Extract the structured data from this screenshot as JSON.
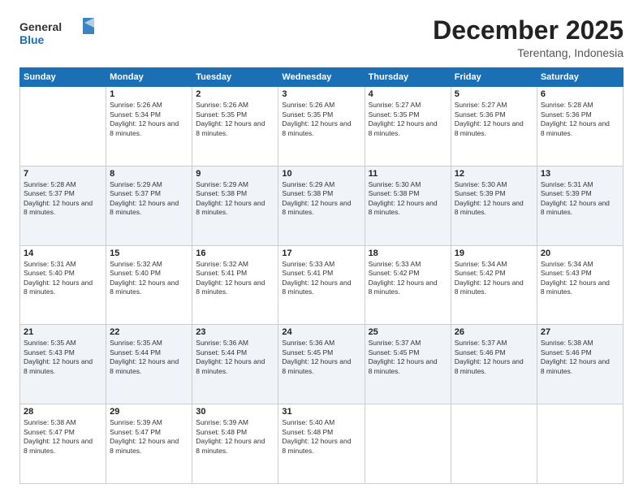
{
  "logo": {
    "general": "General",
    "blue": "Blue"
  },
  "title": "December 2025",
  "location": "Terentang, Indonesia",
  "days_of_week": [
    "Sunday",
    "Monday",
    "Tuesday",
    "Wednesday",
    "Thursday",
    "Friday",
    "Saturday"
  ],
  "weeks": [
    [
      {
        "day": "",
        "sunrise": "",
        "sunset": "",
        "daylight": ""
      },
      {
        "day": "1",
        "sunrise": "5:26 AM",
        "sunset": "5:34 PM",
        "daylight": "12 hours and 8 minutes."
      },
      {
        "day": "2",
        "sunrise": "5:26 AM",
        "sunset": "5:35 PM",
        "daylight": "12 hours and 8 minutes."
      },
      {
        "day": "3",
        "sunrise": "5:26 AM",
        "sunset": "5:35 PM",
        "daylight": "12 hours and 8 minutes."
      },
      {
        "day": "4",
        "sunrise": "5:27 AM",
        "sunset": "5:35 PM",
        "daylight": "12 hours and 8 minutes."
      },
      {
        "day": "5",
        "sunrise": "5:27 AM",
        "sunset": "5:36 PM",
        "daylight": "12 hours and 8 minutes."
      },
      {
        "day": "6",
        "sunrise": "5:28 AM",
        "sunset": "5:36 PM",
        "daylight": "12 hours and 8 minutes."
      }
    ],
    [
      {
        "day": "7",
        "sunrise": "5:28 AM",
        "sunset": "5:37 PM",
        "daylight": "12 hours and 8 minutes."
      },
      {
        "day": "8",
        "sunrise": "5:29 AM",
        "sunset": "5:37 PM",
        "daylight": "12 hours and 8 minutes."
      },
      {
        "day": "9",
        "sunrise": "5:29 AM",
        "sunset": "5:38 PM",
        "daylight": "12 hours and 8 minutes."
      },
      {
        "day": "10",
        "sunrise": "5:29 AM",
        "sunset": "5:38 PM",
        "daylight": "12 hours and 8 minutes."
      },
      {
        "day": "11",
        "sunrise": "5:30 AM",
        "sunset": "5:38 PM",
        "daylight": "12 hours and 8 minutes."
      },
      {
        "day": "12",
        "sunrise": "5:30 AM",
        "sunset": "5:39 PM",
        "daylight": "12 hours and 8 minutes."
      },
      {
        "day": "13",
        "sunrise": "5:31 AM",
        "sunset": "5:39 PM",
        "daylight": "12 hours and 8 minutes."
      }
    ],
    [
      {
        "day": "14",
        "sunrise": "5:31 AM",
        "sunset": "5:40 PM",
        "daylight": "12 hours and 8 minutes."
      },
      {
        "day": "15",
        "sunrise": "5:32 AM",
        "sunset": "5:40 PM",
        "daylight": "12 hours and 8 minutes."
      },
      {
        "day": "16",
        "sunrise": "5:32 AM",
        "sunset": "5:41 PM",
        "daylight": "12 hours and 8 minutes."
      },
      {
        "day": "17",
        "sunrise": "5:33 AM",
        "sunset": "5:41 PM",
        "daylight": "12 hours and 8 minutes."
      },
      {
        "day": "18",
        "sunrise": "5:33 AM",
        "sunset": "5:42 PM",
        "daylight": "12 hours and 8 minutes."
      },
      {
        "day": "19",
        "sunrise": "5:34 AM",
        "sunset": "5:42 PM",
        "daylight": "12 hours and 8 minutes."
      },
      {
        "day": "20",
        "sunrise": "5:34 AM",
        "sunset": "5:43 PM",
        "daylight": "12 hours and 8 minutes."
      }
    ],
    [
      {
        "day": "21",
        "sunrise": "5:35 AM",
        "sunset": "5:43 PM",
        "daylight": "12 hours and 8 minutes."
      },
      {
        "day": "22",
        "sunrise": "5:35 AM",
        "sunset": "5:44 PM",
        "daylight": "12 hours and 8 minutes."
      },
      {
        "day": "23",
        "sunrise": "5:36 AM",
        "sunset": "5:44 PM",
        "daylight": "12 hours and 8 minutes."
      },
      {
        "day": "24",
        "sunrise": "5:36 AM",
        "sunset": "5:45 PM",
        "daylight": "12 hours and 8 minutes."
      },
      {
        "day": "25",
        "sunrise": "5:37 AM",
        "sunset": "5:45 PM",
        "daylight": "12 hours and 8 minutes."
      },
      {
        "day": "26",
        "sunrise": "5:37 AM",
        "sunset": "5:46 PM",
        "daylight": "12 hours and 8 minutes."
      },
      {
        "day": "27",
        "sunrise": "5:38 AM",
        "sunset": "5:46 PM",
        "daylight": "12 hours and 8 minutes."
      }
    ],
    [
      {
        "day": "28",
        "sunrise": "5:38 AM",
        "sunset": "5:47 PM",
        "daylight": "12 hours and 8 minutes."
      },
      {
        "day": "29",
        "sunrise": "5:39 AM",
        "sunset": "5:47 PM",
        "daylight": "12 hours and 8 minutes."
      },
      {
        "day": "30",
        "sunrise": "5:39 AM",
        "sunset": "5:48 PM",
        "daylight": "12 hours and 8 minutes."
      },
      {
        "day": "31",
        "sunrise": "5:40 AM",
        "sunset": "5:48 PM",
        "daylight": "12 hours and 8 minutes."
      },
      {
        "day": "",
        "sunrise": "",
        "sunset": "",
        "daylight": ""
      },
      {
        "day": "",
        "sunrise": "",
        "sunset": "",
        "daylight": ""
      },
      {
        "day": "",
        "sunrise": "",
        "sunset": "",
        "daylight": ""
      }
    ]
  ],
  "labels": {
    "sunrise_prefix": "Sunrise: ",
    "sunset_prefix": "Sunset: ",
    "daylight_prefix": "Daylight: "
  }
}
